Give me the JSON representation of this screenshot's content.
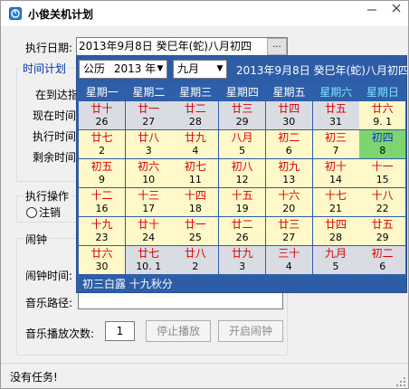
{
  "window": {
    "title": "小俊关机计划",
    "min_icon": "minimize-icon",
    "close_icon": "close-icon"
  },
  "exec_date": {
    "label": "执行日期:",
    "value": "2013年9月8日  癸巳年(蛇)八月初四",
    "dropdown_label": "..."
  },
  "time_plan": {
    "group_title": "时间计划",
    "arrive_label": "在到达指",
    "now_label": "现在时间",
    "exec_label": "执行时间",
    "remain_label": "剩余时间"
  },
  "operation": {
    "group_title": "执行操作",
    "logout_label": "注销"
  },
  "alarm": {
    "group_title": "闹钟",
    "time_label": "闹钟时间:",
    "music_label": "音乐路径:",
    "count_label": "音乐播放次数:",
    "count_value": "1",
    "stop_button": "停止播放",
    "start_button": "开启闹钟"
  },
  "status": {
    "text": "没有任务!"
  },
  "calendar": {
    "calendar_type": "公历",
    "year": "2013 年",
    "month": "九月",
    "header_date": "2013年9月8日  癸巳年(蛇)八月初四",
    "weekdays": [
      "星期一",
      "星期二",
      "星期三",
      "星期四",
      "星期五",
      "星期六",
      "星期日"
    ],
    "weeks": [
      [
        {
          "lunar": "廿十",
          "solar": "26",
          "state": "other"
        },
        {
          "lunar": "廿一",
          "solar": "27",
          "state": "other"
        },
        {
          "lunar": "廿二",
          "solar": "28",
          "state": "other"
        },
        {
          "lunar": "廿三",
          "solar": "29",
          "state": "other"
        },
        {
          "lunar": "廿四",
          "solar": "30",
          "state": "other"
        },
        {
          "lunar": "廿五",
          "solar": "31",
          "state": "other"
        },
        {
          "lunar": "廿六",
          "solar": "9. 1",
          "state": "cur"
        }
      ],
      [
        {
          "lunar": "廿七",
          "solar": "2",
          "state": "cur"
        },
        {
          "lunar": "廿八",
          "solar": "3",
          "state": "cur"
        },
        {
          "lunar": "廿九",
          "solar": "4",
          "state": "cur"
        },
        {
          "lunar": "八月",
          "solar": "5",
          "state": "cur"
        },
        {
          "lunar": "初二",
          "solar": "6",
          "state": "cur"
        },
        {
          "lunar": "初三",
          "solar": "7",
          "state": "cur"
        },
        {
          "lunar": "初四",
          "solar": "8",
          "state": "today"
        }
      ],
      [
        {
          "lunar": "初五",
          "solar": "9",
          "state": "cur"
        },
        {
          "lunar": "初六",
          "solar": "10",
          "state": "cur"
        },
        {
          "lunar": "初七",
          "solar": "11",
          "state": "cur"
        },
        {
          "lunar": "初八",
          "solar": "12",
          "state": "cur"
        },
        {
          "lunar": "初九",
          "solar": "13",
          "state": "cur"
        },
        {
          "lunar": "初十",
          "solar": "14",
          "state": "cur"
        },
        {
          "lunar": "十一",
          "solar": "15",
          "state": "cur"
        }
      ],
      [
        {
          "lunar": "十二",
          "solar": "16",
          "state": "cur"
        },
        {
          "lunar": "十三",
          "solar": "17",
          "state": "cur"
        },
        {
          "lunar": "十四",
          "solar": "18",
          "state": "cur"
        },
        {
          "lunar": "十五",
          "solar": "19",
          "state": "cur"
        },
        {
          "lunar": "十六",
          "solar": "20",
          "state": "cur"
        },
        {
          "lunar": "十七",
          "solar": "21",
          "state": "cur"
        },
        {
          "lunar": "十八",
          "solar": "22",
          "state": "cur"
        }
      ],
      [
        {
          "lunar": "十九",
          "solar": "23",
          "state": "cur"
        },
        {
          "lunar": "廿十",
          "solar": "24",
          "state": "cur"
        },
        {
          "lunar": "廿一",
          "solar": "25",
          "state": "cur"
        },
        {
          "lunar": "廿二",
          "solar": "26",
          "state": "cur"
        },
        {
          "lunar": "廿三",
          "solar": "27",
          "state": "cur"
        },
        {
          "lunar": "廿四",
          "solar": "28",
          "state": "cur"
        },
        {
          "lunar": "廿五",
          "solar": "29",
          "state": "cur"
        }
      ],
      [
        {
          "lunar": "廿六",
          "solar": "30",
          "state": "cur"
        },
        {
          "lunar": "廿七",
          "solar": "10. 1",
          "state": "other"
        },
        {
          "lunar": "廿八",
          "solar": "2",
          "state": "other"
        },
        {
          "lunar": "廿九",
          "solar": "3",
          "state": "other"
        },
        {
          "lunar": "三十",
          "solar": "4",
          "state": "other"
        },
        {
          "lunar": "九月",
          "solar": "5",
          "state": "other"
        },
        {
          "lunar": "初二",
          "solar": "6",
          "state": "other"
        }
      ]
    ],
    "solar_terms": "初三白露   十九秋分"
  },
  "colors": {
    "calendar_blue": "#2e5fa8",
    "weekend_header": "#7fe3ff",
    "today_green": "#7ed46e",
    "lunar_red": "#e00000",
    "current_month_bg": "#fff8c8",
    "other_month_bg": "#d9dce3"
  }
}
